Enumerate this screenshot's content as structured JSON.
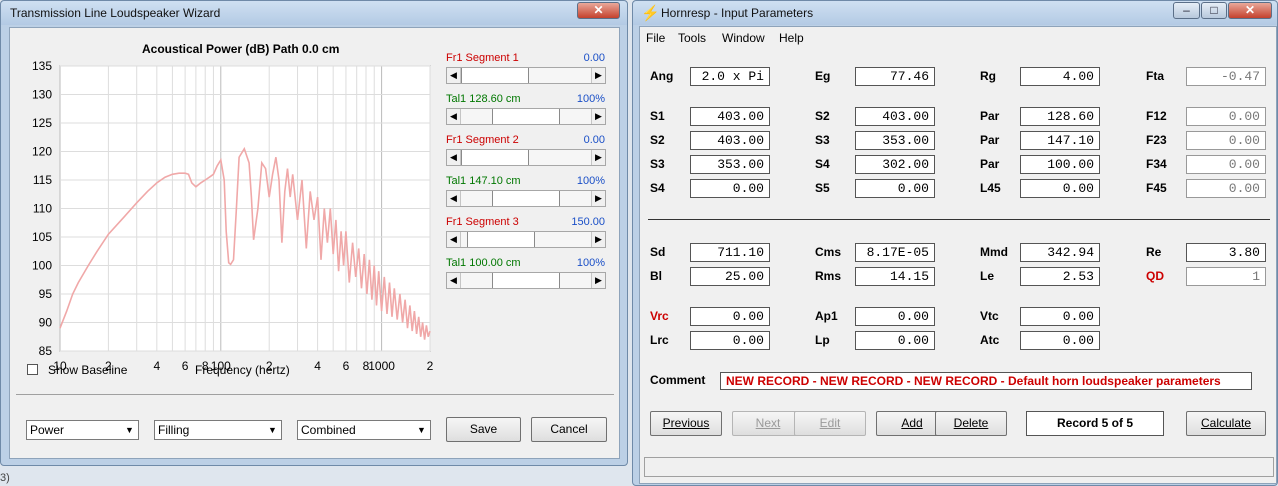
{
  "left": {
    "title": "Transmission Line Loudspeaker Wizard",
    "chart_header": "Acoustical Power (dB)   Path 0.0 cm",
    "show_baseline": "Show Baseline",
    "freq_label": "Frequency (hertz)",
    "segments": [
      {
        "label": "Fr1   Segment 1",
        "value": "0.00",
        "color": "#cc0000",
        "thumb": 0.0
      },
      {
        "label": "Tal1   128.60 cm",
        "value": "100%",
        "color": "#007700",
        "thumb": 0.49
      },
      {
        "label": "Fr1   Segment 2",
        "value": "0.00",
        "color": "#cc0000",
        "thumb": 0.0
      },
      {
        "label": "Tal1   147.10 cm",
        "value": "100%",
        "color": "#007700",
        "thumb": 0.49
      },
      {
        "label": "Fr1   Segment 3",
        "value": "150.00",
        "color": "#cc0000",
        "thumb": 0.1
      },
      {
        "label": "Tal1   100.00 cm",
        "value": "100%",
        "color": "#007700",
        "thumb": 0.49
      }
    ],
    "selects": [
      "Power",
      "Filling",
      "Combined"
    ],
    "save": "Save",
    "cancel": "Cancel"
  },
  "right": {
    "title": "Hornresp - Input Parameters",
    "menu": [
      "File",
      "Tools",
      "Window",
      "Help"
    ],
    "rows1": [
      [
        {
          "l": "Ang",
          "v": "2.0 x Pi"
        },
        {
          "l": "Eg",
          "v": "77.46"
        },
        {
          "l": "Rg",
          "v": "4.00"
        },
        {
          "l": "Fta",
          "v": "-0.47",
          "ro": true
        }
      ]
    ],
    "rows2": [
      [
        {
          "l": "S1",
          "v": "403.00"
        },
        {
          "l": "S2",
          "v": "403.00"
        },
        {
          "l": "Par",
          "v": "128.60"
        },
        {
          "l": "F12",
          "v": "0.00",
          "ro": true
        }
      ],
      [
        {
          "l": "S2",
          "v": "403.00"
        },
        {
          "l": "S3",
          "v": "353.00"
        },
        {
          "l": "Par",
          "v": "147.10"
        },
        {
          "l": "F23",
          "v": "0.00",
          "ro": true
        }
      ],
      [
        {
          "l": "S3",
          "v": "353.00"
        },
        {
          "l": "S4",
          "v": "302.00"
        },
        {
          "l": "Par",
          "v": "100.00"
        },
        {
          "l": "F34",
          "v": "0.00",
          "ro": true
        }
      ],
      [
        {
          "l": "S4",
          "v": "0.00"
        },
        {
          "l": "S5",
          "v": "0.00"
        },
        {
          "l": "L45",
          "v": "0.00"
        },
        {
          "l": "F45",
          "v": "0.00",
          "ro": true
        }
      ]
    ],
    "rows3": [
      [
        {
          "l": "Sd",
          "v": "711.10"
        },
        {
          "l": "Cms",
          "v": "8.17E-05"
        },
        {
          "l": "Mmd",
          "v": "342.94"
        },
        {
          "l": "Re",
          "v": "3.80"
        }
      ],
      [
        {
          "l": "Bl",
          "v": "25.00"
        },
        {
          "l": "Rms",
          "v": "14.15"
        },
        {
          "l": "Le",
          "v": "2.53"
        },
        {
          "l": "QD",
          "v": "1",
          "red": true,
          "ro": true
        }
      ]
    ],
    "rows4": [
      [
        {
          "l": "Vrc",
          "v": "0.00",
          "red": true
        },
        {
          "l": "Ap1",
          "v": "0.00"
        },
        {
          "l": "Vtc",
          "v": "0.00"
        }
      ],
      [
        {
          "l": "Lrc",
          "v": "0.00"
        },
        {
          "l": "Lp",
          "v": "0.00"
        },
        {
          "l": "Atc",
          "v": "0.00"
        }
      ]
    ],
    "comment_label": "Comment",
    "comment": "NEW RECORD - NEW RECORD - NEW RECORD - Default horn loudspeaker parameters",
    "buttons": {
      "previous": "Previous",
      "next": "Next",
      "edit": "Edit",
      "add": "Add",
      "delete": "Delete",
      "calculate": "Calculate"
    },
    "record": "Record 5 of 5"
  },
  "footer_text": "3)",
  "chart_data": {
    "type": "line",
    "title": "Acoustical Power (dB)   Path 0.0 cm",
    "xlabel": "Frequency (hertz)",
    "ylabel": "",
    "x_scale": "log",
    "xlim": [
      10,
      2000
    ],
    "ylim": [
      85,
      135
    ],
    "yticks": [
      85,
      90,
      95,
      100,
      105,
      110,
      115,
      120,
      125,
      130,
      135
    ],
    "xtick_labels": [
      "10",
      "2",
      "4",
      "6",
      "8",
      "100",
      "2",
      "4",
      "6",
      "8",
      "1000",
      "2"
    ],
    "grid": true,
    "series": [
      {
        "color": "#f0a8a8",
        "x": [
          10,
          11,
          12,
          13,
          15,
          17,
          20,
          25,
          30,
          35,
          40,
          45,
          50,
          55,
          60,
          63,
          66,
          70,
          75,
          80,
          85,
          90,
          95,
          100,
          105,
          108,
          112,
          115,
          120,
          125,
          130,
          140,
          150,
          155,
          160,
          170,
          180,
          190,
          200,
          210,
          220,
          230,
          240,
          250,
          260,
          270,
          280,
          300,
          320,
          340,
          360,
          380,
          400,
          420,
          440,
          460,
          480,
          500,
          520,
          540,
          560,
          580,
          600,
          630,
          660,
          690,
          720,
          750,
          780,
          810,
          840,
          870,
          900,
          930,
          960,
          1000,
          1040,
          1080,
          1120,
          1160,
          1200,
          1250,
          1300,
          1350,
          1400,
          1450,
          1500,
          1550,
          1600,
          1650,
          1700,
          1750,
          1800,
          1850,
          1900,
          1950,
          2000
        ],
        "y": [
          89,
          92,
          95,
          97,
          100,
          102.5,
          105.5,
          108.5,
          111,
          113,
          114.5,
          115.5,
          116,
          116.2,
          116.2,
          116,
          114.5,
          113.8,
          114.5,
          115,
          115.5,
          116,
          117.5,
          118.5,
          115,
          106,
          100.5,
          100.2,
          101,
          110,
          119,
          120.5,
          118,
          112,
          104.5,
          110,
          118,
          117,
          112,
          116,
          119,
          115,
          104,
          113,
          117,
          112,
          116,
          108,
          115,
          103,
          113,
          108,
          112,
          101,
          110,
          104,
          110,
          102,
          108,
          99,
          106,
          100,
          106,
          97,
          104,
          98,
          103,
          96,
          102,
          95,
          101,
          94,
          100,
          93,
          99,
          92,
          98,
          91.5,
          97,
          91,
          96,
          90.5,
          95,
          90,
          94,
          89,
          93,
          88.5,
          92,
          88,
          91,
          87.5,
          90,
          87,
          89.5,
          87.5,
          88.5
        ]
      }
    ]
  }
}
